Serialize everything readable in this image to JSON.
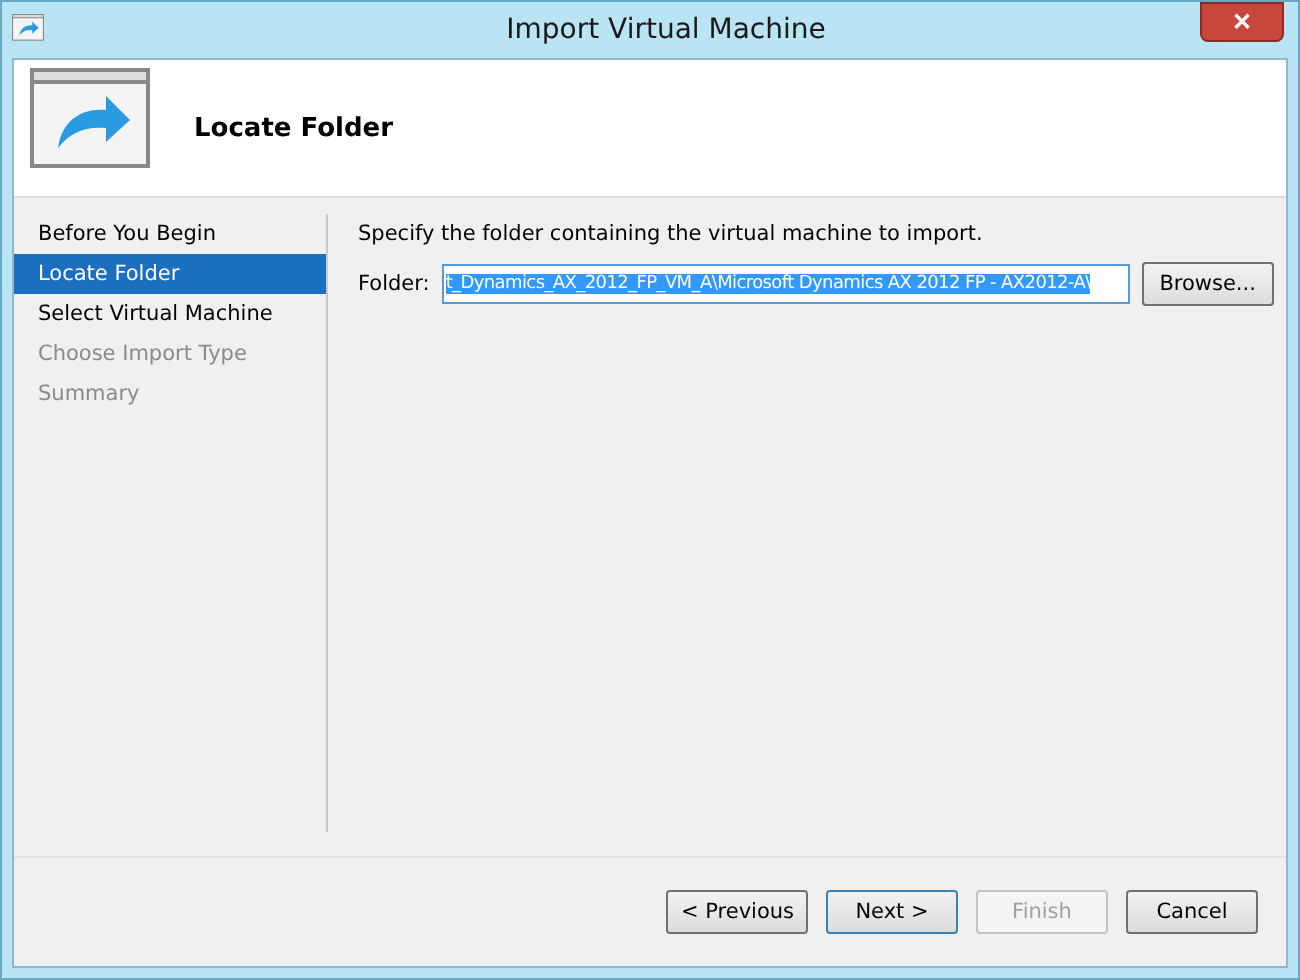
{
  "window": {
    "title": "Import Virtual Machine",
    "close": "✕"
  },
  "header": {
    "title": "Locate Folder"
  },
  "steps": [
    {
      "label": "Before You Begin",
      "selected": false,
      "disabled": false
    },
    {
      "label": "Locate Folder",
      "selected": true,
      "disabled": false
    },
    {
      "label": "Select Virtual Machine",
      "selected": false,
      "disabled": false
    },
    {
      "label": "Choose Import Type",
      "selected": false,
      "disabled": true
    },
    {
      "label": "Summary",
      "selected": false,
      "disabled": true
    }
  ],
  "instruction": "Specify the folder containing the virtual machine to import.",
  "folder": {
    "label": "Folder:",
    "value": "t_Dynamics_AX_2012_FP_VM_A\\Microsoft Dynamics AX 2012 FP - AX2012-A\\",
    "selected": true,
    "button": "Browse..."
  },
  "buttons": [
    {
      "label": "< Previous",
      "disabled": false,
      "default": false
    },
    {
      "label": "Next >",
      "disabled": false,
      "default": true
    },
    {
      "label": "Finish",
      "disabled": true,
      "default": false
    },
    {
      "label": "Cancel",
      "disabled": false,
      "default": false
    }
  ]
}
